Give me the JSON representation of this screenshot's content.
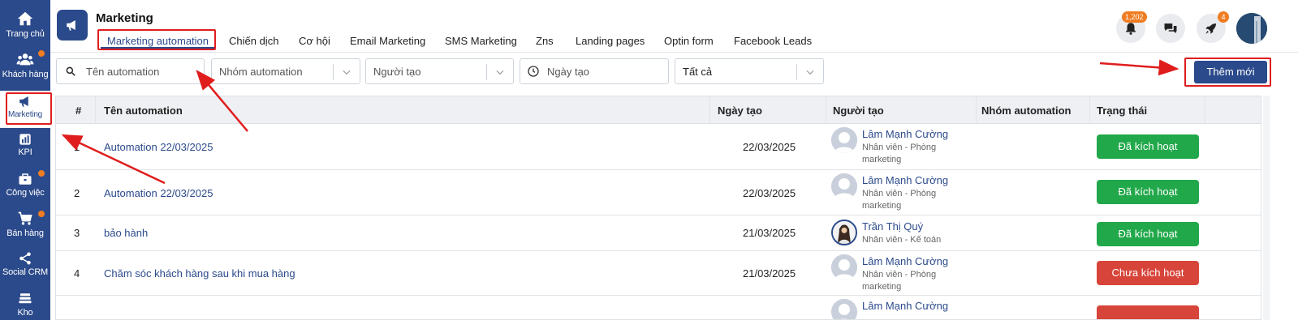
{
  "sidebar": {
    "items": [
      {
        "label": "Trang chủ",
        "icon": "home-icon"
      },
      {
        "label": "Khách hàng",
        "icon": "users-icon"
      },
      {
        "label": "Marketing",
        "icon": "megaphone-icon"
      },
      {
        "label": "KPI",
        "icon": "bar-chart-icon"
      },
      {
        "label": "Công việc",
        "icon": "briefcase-icon"
      },
      {
        "label": "Bán hàng",
        "icon": "cart-icon"
      },
      {
        "label": "Social CRM",
        "icon": "share-icon"
      },
      {
        "label": "Kho",
        "icon": "stack-icon"
      }
    ]
  },
  "header": {
    "title": "Marketing",
    "tabs": [
      {
        "label": "Marketing automation"
      },
      {
        "label": "Chiến dịch"
      },
      {
        "label": "Cơ hội"
      },
      {
        "label": "Email Marketing"
      },
      {
        "label": "SMS Marketing"
      },
      {
        "label": "Zns"
      },
      {
        "label": "Landing pages"
      },
      {
        "label": "Optin form"
      },
      {
        "label": "Facebook Leads"
      }
    ],
    "notification_count": "1,202",
    "rocket_count": "4"
  },
  "filters": {
    "search_placeholder": "Tên automation",
    "group_placeholder": "Nhóm automation",
    "creator_placeholder": "Người tạo",
    "date_placeholder": "Ngày tạo",
    "status_value": "Tất cả"
  },
  "add_button": "Thêm mới",
  "table": {
    "headers": {
      "idx": "#",
      "name": "Tên automation",
      "date": "Ngày tạo",
      "creator": "Người tạo",
      "group": "Nhóm automation",
      "status": "Trạng thái"
    },
    "rows": [
      {
        "idx": "1",
        "name": "Automation 22/03/2025",
        "date": "22/03/2025",
        "creator": "Lâm Mạnh Cường",
        "role": "Nhân viên - Phòng marketing",
        "status": "Đã kích hoạt"
      },
      {
        "idx": "2",
        "name": "Automation 22/03/2025",
        "date": "22/03/2025",
        "creator": "Lâm Mạnh Cường",
        "role": "Nhân viên - Phòng marketing",
        "status": "Đã kích hoạt"
      },
      {
        "idx": "3",
        "name": "bảo hành",
        "date": "21/03/2025",
        "creator": "Trần Thị Quý",
        "role": "Nhân viên - Kế toán",
        "status": "Đã kích hoạt"
      },
      {
        "idx": "4",
        "name": "Chăm sóc khách hàng sau khi mua hàng",
        "date": "21/03/2025",
        "creator": "Lâm Mạnh Cường",
        "role": "Nhân viên - Phòng marketing",
        "status": "Chưa kích hoạt"
      },
      {
        "idx": "",
        "name": "",
        "date": "",
        "creator": "Lâm Mạnh Cường",
        "role": "",
        "status": ""
      }
    ]
  },
  "colors": {
    "primary": "#2b4a8b",
    "active_status": "#21a84a",
    "inactive_status": "#d7453a",
    "badge": "#f07d22",
    "annotation": "#e01d1d"
  }
}
